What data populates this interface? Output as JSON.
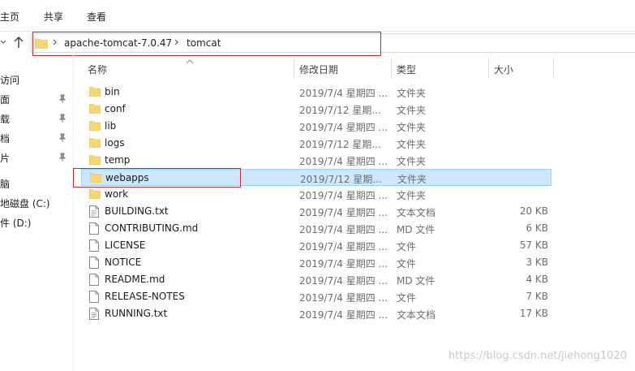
{
  "ribbon": {
    "tabs": [
      "主页",
      "共享",
      "查看"
    ]
  },
  "address": {
    "crumbs": [
      "apache-tomcat-7.0.47",
      "tomcat"
    ]
  },
  "nav": {
    "items": [
      {
        "label": "访问",
        "pinned": false
      },
      {
        "label": "面",
        "pinned": true
      },
      {
        "label": "载",
        "pinned": true
      },
      {
        "label": "档",
        "pinned": true
      },
      {
        "label": "片",
        "pinned": true
      },
      {
        "label": "脑",
        "pinned": false
      },
      {
        "label": "地磁盘 (C:)",
        "pinned": false
      },
      {
        "label": "件 (D:)",
        "pinned": false
      }
    ]
  },
  "columns": {
    "name": "名称",
    "date": "修改日期",
    "type": "类型",
    "size": "大小"
  },
  "files": [
    {
      "name": "bin",
      "date": "2019/7/4 星期四 ...",
      "type": "文件夹",
      "size": "",
      "kind": "folder"
    },
    {
      "name": "conf",
      "date": "2019/7/12 星期...",
      "type": "文件夹",
      "size": "",
      "kind": "folder"
    },
    {
      "name": "lib",
      "date": "2019/7/4 星期四 ...",
      "type": "文件夹",
      "size": "",
      "kind": "folder"
    },
    {
      "name": "logs",
      "date": "2019/7/12 星期...",
      "type": "文件夹",
      "size": "",
      "kind": "folder"
    },
    {
      "name": "temp",
      "date": "2019/7/4 星期四 ...",
      "type": "文件夹",
      "size": "",
      "kind": "folder"
    },
    {
      "name": "webapps",
      "date": "2019/7/12 星期...",
      "type": "文件夹",
      "size": "",
      "kind": "folder",
      "selected": true
    },
    {
      "name": "work",
      "date": "2019/7/4 星期四 ...",
      "type": "文件夹",
      "size": "",
      "kind": "folder"
    },
    {
      "name": "BUILDING.txt",
      "date": "2019/7/4 星期四 ...",
      "type": "文本文档",
      "size": "20 KB",
      "kind": "text"
    },
    {
      "name": "CONTRIBUTING.md",
      "date": "2019/7/4 星期四 ...",
      "type": "MD 文件",
      "size": "6 KB",
      "kind": "file"
    },
    {
      "name": "LICENSE",
      "date": "2019/7/4 星期四 ...",
      "type": "文件",
      "size": "57 KB",
      "kind": "file"
    },
    {
      "name": "NOTICE",
      "date": "2019/7/4 星期四 ...",
      "type": "文件",
      "size": "3 KB",
      "kind": "file"
    },
    {
      "name": "README.md",
      "date": "2019/7/4 星期四 ...",
      "type": "MD 文件",
      "size": "4 KB",
      "kind": "file"
    },
    {
      "name": "RELEASE-NOTES",
      "date": "2019/7/4 星期四 ...",
      "type": "文件",
      "size": "7 KB",
      "kind": "file"
    },
    {
      "name": "RUNNING.txt",
      "date": "2019/7/4 星期四 ...",
      "type": "文本文档",
      "size": "17 KB",
      "kind": "text"
    }
  ],
  "watermark": "https://blog.csdn.net/jiehong1020",
  "colors": {
    "selection": "#cce8ff",
    "annotation": "#d7282b",
    "folder": "#f7d774"
  }
}
